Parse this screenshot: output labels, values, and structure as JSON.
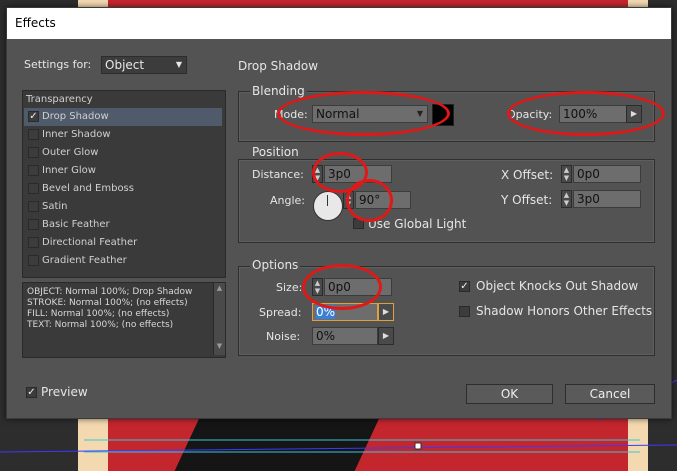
{
  "dialog": {
    "title": "Effects",
    "settings_for_label": "Settings for:",
    "settings_for_value": "Object"
  },
  "effects_list": {
    "header": "Transparency",
    "items": [
      {
        "label": "Drop Shadow",
        "checked": true,
        "selected": true
      },
      {
        "label": "Inner Shadow",
        "checked": false
      },
      {
        "label": "Outer Glow",
        "checked": false
      },
      {
        "label": "Inner Glow",
        "checked": false
      },
      {
        "label": "Bevel and Emboss",
        "checked": false
      },
      {
        "label": "Satin",
        "checked": false
      },
      {
        "label": "Basic Feather",
        "checked": false
      },
      {
        "label": "Directional Feather",
        "checked": false
      },
      {
        "label": "Gradient Feather",
        "checked": false
      }
    ]
  },
  "summary": [
    "OBJECT: Normal 100%; Drop Shadow",
    "STROKE: Normal 100%; (no effects)",
    "FILL: Normal 100%; (no effects)",
    "TEXT: Normal 100%; (no effects)"
  ],
  "panel_title": "Drop Shadow",
  "blending": {
    "section": "Blending",
    "mode_label": "Mode:",
    "mode_value": "Normal",
    "color_swatch": "#000000",
    "opacity_label": "Opacity:",
    "opacity_value": "100%"
  },
  "position": {
    "section": "Position",
    "distance_label": "Distance:",
    "distance_value": "3p0",
    "angle_label": "Angle:",
    "angle_value": "90°",
    "global_light_label": "Use Global Light",
    "x_offset_label": "X Offset:",
    "x_offset_value": "0p0",
    "y_offset_label": "Y Offset:",
    "y_offset_value": "3p0"
  },
  "options": {
    "section": "Options",
    "size_label": "Size:",
    "size_value": "0p0",
    "spread_label": "Spread:",
    "spread_value": "0%",
    "noise_label": "Noise:",
    "noise_value": "0%",
    "knocks_out_label": "Object Knocks Out Shadow",
    "knocks_out_checked": true,
    "honors_label": "Shadow Honors Other Effects",
    "honors_checked": false
  },
  "footer": {
    "preview_label": "Preview",
    "preview_checked": true,
    "ok_label": "OK",
    "cancel_label": "Cancel"
  },
  "colors": {
    "dialog_bg": "#535353",
    "annotation_red": "#e01818",
    "artwork_red": "#c4262e"
  }
}
